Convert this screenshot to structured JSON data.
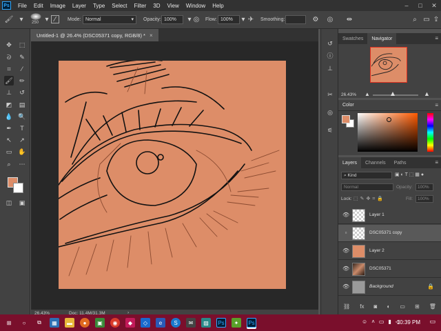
{
  "app": {
    "logo_text": "Ps",
    "menu": [
      "File",
      "Edit",
      "Image",
      "Layer",
      "Type",
      "Select",
      "Filter",
      "3D",
      "View",
      "Window",
      "Help"
    ]
  },
  "options": {
    "brush_size": "250",
    "mode_label": "Mode:",
    "mode_value": "Normal",
    "opacity_label": "Opacity:",
    "opacity_value": "100%",
    "flow_label": "Flow:",
    "flow_value": "100%",
    "smoothing_label": "Smoothing:",
    "smoothing_value": ""
  },
  "document": {
    "tab_title": "Untitled-1 @ 26.4% (DSC05371 copy, RGB/8) *",
    "close_symbol": "×",
    "zoom": "26.43%",
    "doc_size": "Doc: 11.4M/31.3M",
    "canvas_color": "#dd8d68"
  },
  "navigator": {
    "tabs": [
      "Swatches",
      "Navigator"
    ],
    "active_tab": "Navigator",
    "zoom": "26.43%"
  },
  "color_panel": {
    "title": "Color",
    "foreground": "#dd8d68",
    "background": "#ffffff"
  },
  "layers_panel": {
    "tabs": [
      "Layers",
      "Channels",
      "Paths"
    ],
    "active_tab": "Layers",
    "filter_kind": "Kind",
    "blend_mode": "Normal",
    "opacity_label": "Opacity:",
    "opacity_value": "100%",
    "lock_label": "Lock:",
    "fill_label": "Fill:",
    "fill_value": "100%",
    "layers": [
      {
        "name": "Layer 1",
        "visible": true,
        "selected": false,
        "thumb": "transparent"
      },
      {
        "name": "DSC05371 copy",
        "visible": false,
        "selected": true,
        "thumb": "transparent"
      },
      {
        "name": "Layer 2",
        "visible": true,
        "selected": false,
        "thumb": "#dd8d68"
      },
      {
        "name": "DSC05371",
        "visible": true,
        "selected": false,
        "thumb": "photo"
      },
      {
        "name": "Background",
        "visible": true,
        "selected": false,
        "thumb": "#9a9a9a",
        "locked": true
      }
    ]
  },
  "taskbar": {
    "time": "10:39 PM",
    "accent": "#7a0f2c"
  }
}
